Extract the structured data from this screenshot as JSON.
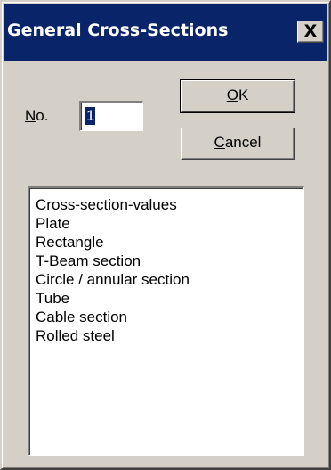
{
  "window": {
    "title": "General Cross-Sections",
    "close_glyph": "X"
  },
  "form": {
    "no_label_mnemonic": "N",
    "no_label_rest": "o.",
    "no_value": "1"
  },
  "buttons": {
    "ok_mnemonic": "O",
    "ok_rest": "K",
    "cancel_mnemonic": "C",
    "cancel_rest": "ancel"
  },
  "list": {
    "items": [
      "Cross-section-values",
      "Plate",
      "Rectangle",
      "T-Beam section",
      "Circle / annular section",
      "Tube",
      "Cable section",
      "Rolled steel"
    ]
  },
  "colors": {
    "titlebar": "#0a246a",
    "face": "#d4d0c8",
    "selection": "#0a246a"
  }
}
